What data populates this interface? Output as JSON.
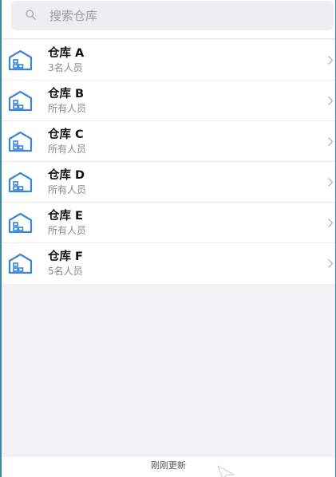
{
  "search": {
    "placeholder": "搜索仓库",
    "icon": "search-icon"
  },
  "warehouses": [
    {
      "name": "仓库 A",
      "members": "3名人员",
      "icon": "warehouse-icon"
    },
    {
      "name": "仓库 B",
      "members": "所有人员",
      "icon": "warehouse-icon"
    },
    {
      "name": "仓库 C",
      "members": "所有人员",
      "icon": "warehouse-icon"
    },
    {
      "name": "仓库 D",
      "members": "所有人员",
      "icon": "warehouse-icon"
    },
    {
      "name": "仓库 E",
      "members": "所有人员",
      "icon": "warehouse-icon"
    },
    {
      "name": "仓库 F",
      "members": "5名人员",
      "icon": "warehouse-icon"
    }
  ],
  "footer": {
    "status": "刚刚更新"
  },
  "colors": {
    "accent": "#3a86d9",
    "background": "#f2f2f4",
    "frame": "#3c86a6"
  }
}
